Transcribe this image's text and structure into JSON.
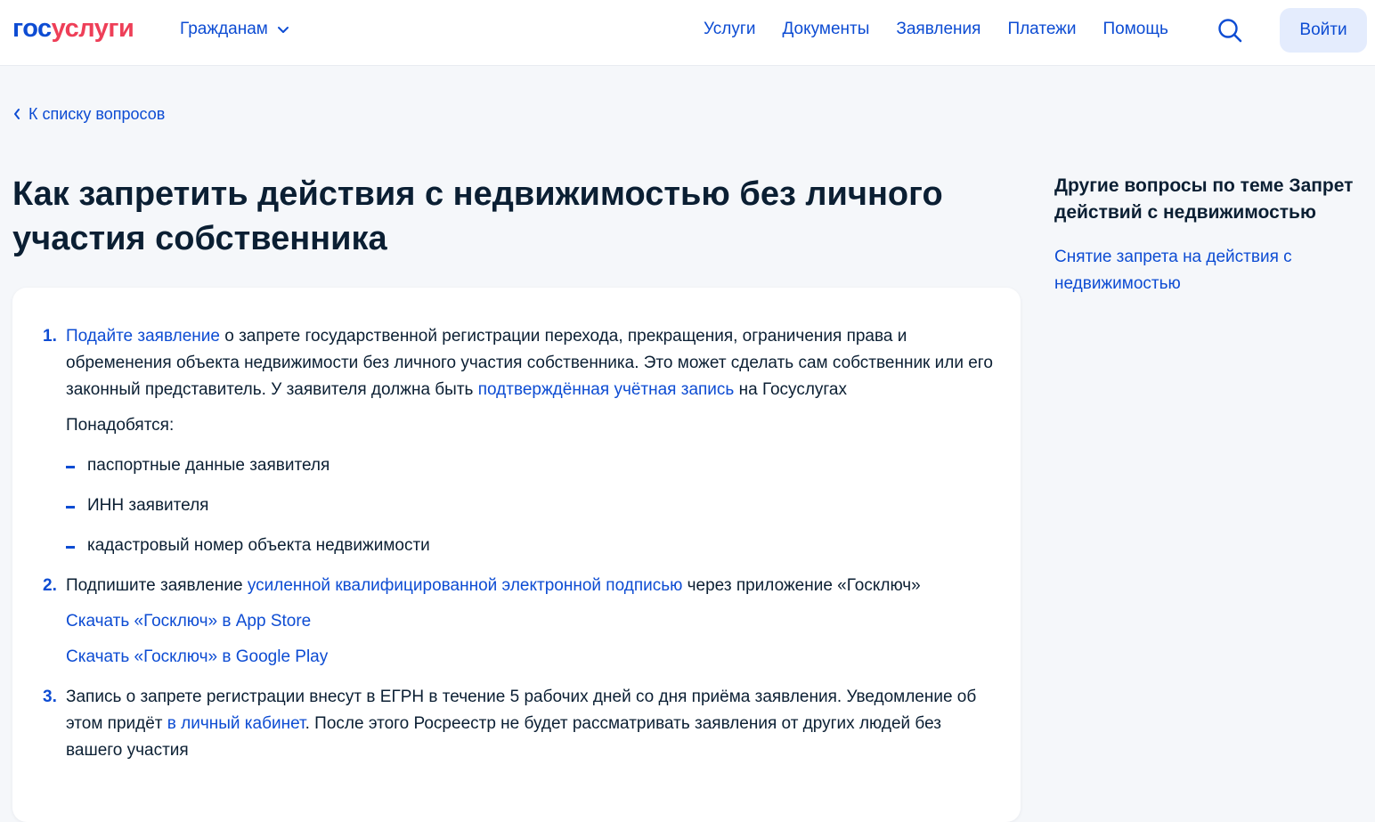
{
  "header": {
    "logo_part1": "гос",
    "logo_part2": "услуги",
    "citizens_label": "Гражданам",
    "nav": [
      "Услуги",
      "Документы",
      "Заявления",
      "Платежи",
      "Помощь"
    ],
    "login_label": "Войти"
  },
  "back_link": "К списку вопросов",
  "title": "Как запретить действия с недвижимостью без личного участия собственника",
  "steps": {
    "s1": {
      "num": "1.",
      "link1": "Подайте заявление",
      "text1": " о запрете государственной регистрации перехода, прекращения, ограничения права и обременения объекта недвижимости без личного участия собственника. Это может сделать сам собственник или его законный представитель. У заявителя должна быть ",
      "link2": "подтверждённая учётная запись",
      "text2": " на Госуслугах",
      "needed": "Понадобятся:",
      "items": [
        "паспортные данные заявителя",
        "ИНН заявителя",
        "кадастровый номер объекта недвижимости"
      ]
    },
    "s2": {
      "num": "2.",
      "text1": "Подпишите заявление ",
      "link1": "усиленной квалифицированной электронной подписью",
      "text2": " через приложение «Госключ»",
      "appstore": "Скачать «Госключ» в App Store",
      "googleplay": "Скачать «Госключ» в Google Play"
    },
    "s3": {
      "num": "3.",
      "text1": "Запись о запрете регистрации внесут в ЕГРН в течение 5 рабочих дней со дня приёма заявления. Уведомление об этом придёт ",
      "link1": "в личный кабинет",
      "text2": ". После этого Росреестр не будет рассматривать заявления от других людей без вашего участия"
    }
  },
  "sidebar": {
    "title": "Другие вопросы по теме Запрет действий с недвижимостью",
    "link": "Снятие запрета на действия с недвижимостью"
  },
  "colors": {
    "accent": "#0d4cd3",
    "logo_red": "#ee3f58",
    "text": "#0b1f33",
    "bg": "#f5f7fa"
  }
}
